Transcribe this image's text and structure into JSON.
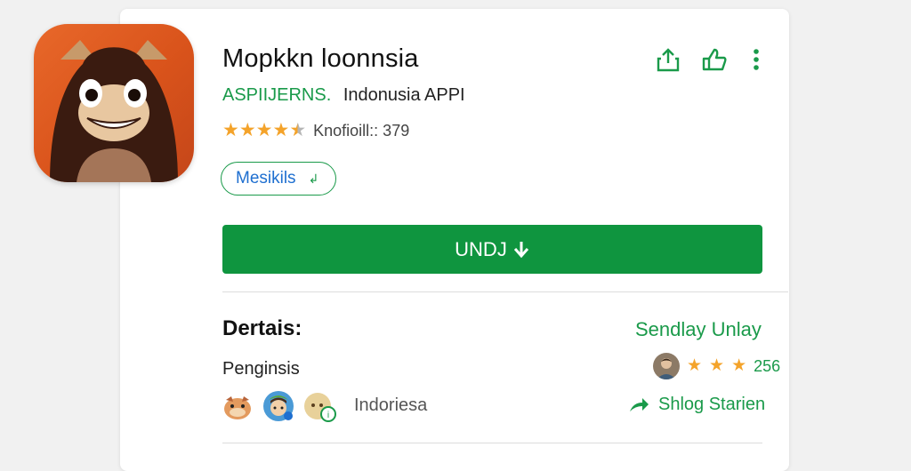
{
  "app": {
    "title": "Mopkkn loonnsia",
    "developer": "ASPIIJERNS.",
    "developer_sub": "Indonusia APPI",
    "rating_text": "Knofioill:: 379",
    "rating_stars": 4.5,
    "details_pill_label": "Mesikils",
    "install_label": "UNDJ",
    "icon": "cartoon-animal-app-icon"
  },
  "actions": {
    "share_icon": "share-icon",
    "wishlist_icon": "wishlist-icon",
    "more_icon": "more-vert-icon"
  },
  "details": {
    "heading": "Dertais:",
    "see_all": "Sendlay Unlay",
    "category": "Penginsis",
    "review_stars": 3,
    "review_count": "256",
    "region": "Indoriesa",
    "share_label": "Shlog Starien"
  },
  "colors": {
    "accent_green": "#0f953f",
    "text_green": "#1a9a4a",
    "link_blue": "#1e6fd0",
    "star": "#f4a32a",
    "icon_orange": "#e8682a"
  }
}
